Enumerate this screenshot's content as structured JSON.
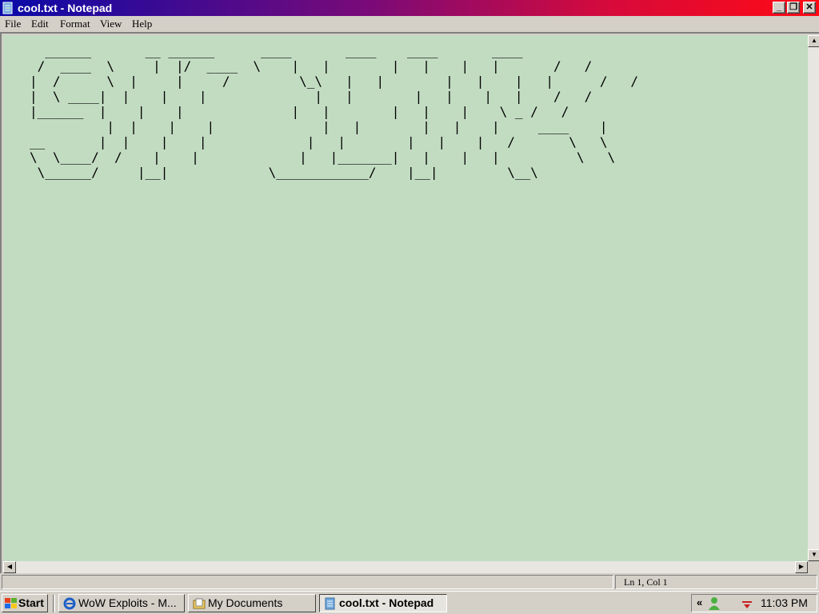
{
  "window": {
    "title": "cool.txt - Notepad",
    "buttons": {
      "minimize": "_",
      "restore": "❐",
      "close": "✕"
    }
  },
  "menu": [
    "File",
    "Edit",
    "Format",
    "View",
    "Help"
  ],
  "document": {
    "content": "  ______       __ ______      ____       ____    ____       ____\n /  ____  \\     |  |/  ____  \\    |   |        |   |    |   |       /   /\n|  /      \\  |     |     /         \\_\\   |   |        |   |    |   |      /   /\n|  \\ ____|  |    |    |              |   |        |   |    |   |    /   /\n|______  |    |    |              |   |        |   |    |    \\ _ /   /\n          |  |    |    |              |   |        |   |    |     ____    |\n__       |  |    |    |             |   |        |   |    |   /       \\   \\\n\\  \\____/  /    |    |             |   |_______|   |    |   |          \\   \\\n \\______/     |__|             \\____________/    |__|         \\__\\"
  },
  "scrollbar": {
    "up": "▲",
    "down": "▼",
    "left": "◀",
    "right": "▶"
  },
  "status": {
    "position": "Ln 1, Col 1"
  },
  "taskbar": {
    "start_label": "Start",
    "items": [
      {
        "label": "WoW Exploits - M...",
        "active": false
      },
      {
        "label": "My Documents",
        "active": false
      },
      {
        "label": "cool.txt - Notepad",
        "active": true
      }
    ],
    "tray": {
      "chevron": "«",
      "clock": "11:03 PM"
    }
  },
  "colors": {
    "text_background": "#c2dcc2",
    "title_start": "#0a0aa8",
    "title_end": "#ff0a14"
  }
}
